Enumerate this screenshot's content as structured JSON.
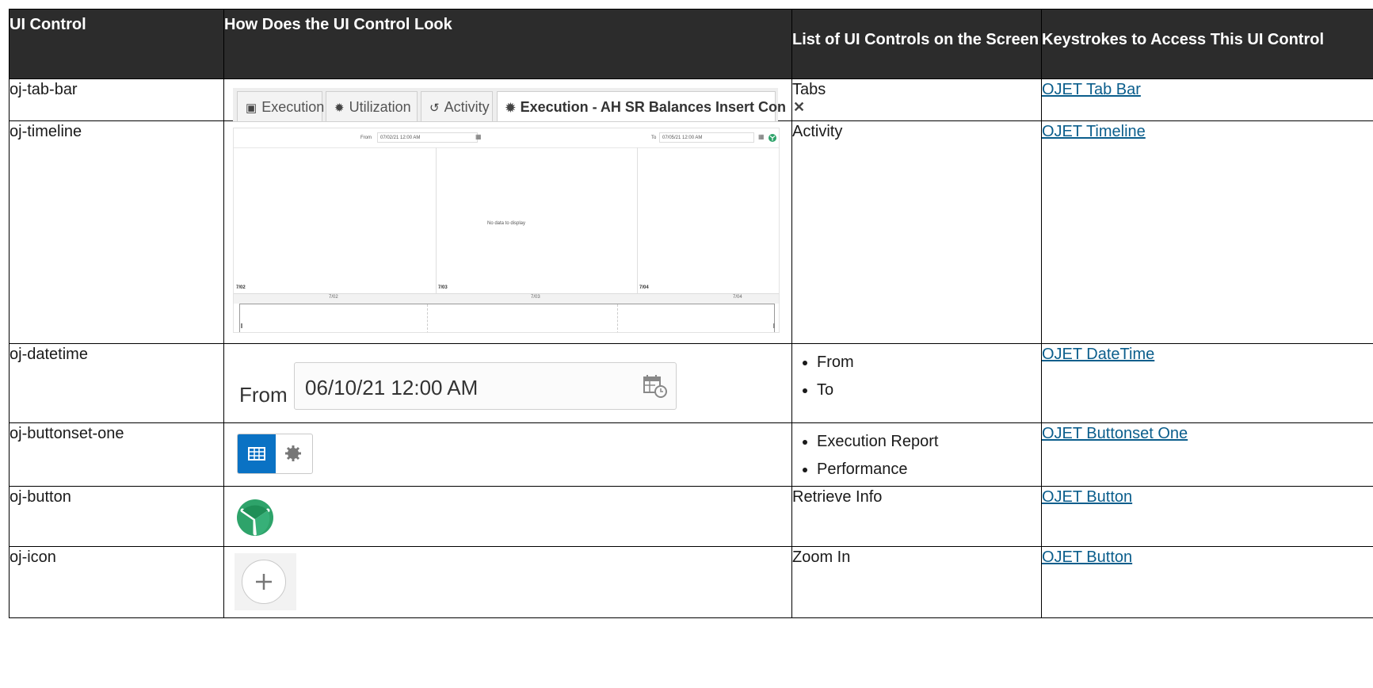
{
  "headers": [
    "UI Control",
    "How Does the UI Control Look",
    "List of UI Controls on the Screen",
    "Keystrokes to Access This UI Control"
  ],
  "rows": [
    {
      "control": "oj-tab-bar",
      "screen_controls": "Tabs",
      "link": "OJET Tab Bar"
    },
    {
      "control": "oj-timeline",
      "screen_controls": "Activity",
      "link": "OJET Timeline"
    },
    {
      "control": "oj-datetime",
      "screen_controls": [
        "From",
        "To"
      ],
      "link": "OJET DateTime"
    },
    {
      "control": "oj-buttonset-one",
      "screen_controls": [
        "Execution Report",
        "Performance"
      ],
      "link": "OJET Buttonset One"
    },
    {
      "control": "oj-button",
      "screen_controls": "Retrieve Info",
      "link": "OJET Button"
    },
    {
      "control": "oj-icon",
      "screen_controls": "Zoom In",
      "link": "OJET Button"
    }
  ],
  "tabbar": {
    "tabs": [
      {
        "label": "Execution",
        "icon": "execution-icon"
      },
      {
        "label": "Utilization",
        "icon": "gear-icon"
      },
      {
        "label": "Activity",
        "icon": "history-icon"
      },
      {
        "label": "Execution - AH SR Balances Insert Con",
        "icon": "gear-icon",
        "selected": true,
        "close_icon": "close-icon"
      }
    ]
  },
  "timeline": {
    "from_label": "From",
    "from_value": "07/02/21 12:00 AM",
    "to_label": "To",
    "to_value": "07/05/21 12:00 AM",
    "no_data": "No data to display",
    "dates": [
      "7/02",
      "7/03",
      "7/04"
    ]
  },
  "datetime": {
    "label": "From",
    "value": "06/10/21 12:00 AM",
    "icon": "calendar-clock-icon"
  },
  "buttonset": {
    "buttons": [
      {
        "icon": "table-icon",
        "selected": true,
        "color": "#0a72c4"
      },
      {
        "icon": "gear-icon",
        "selected": false
      }
    ]
  },
  "retrieve_button": {
    "icon": "retrieve-info-icon",
    "color": "#2ea36a"
  },
  "zoom_button": {
    "icon": "plus-icon"
  }
}
